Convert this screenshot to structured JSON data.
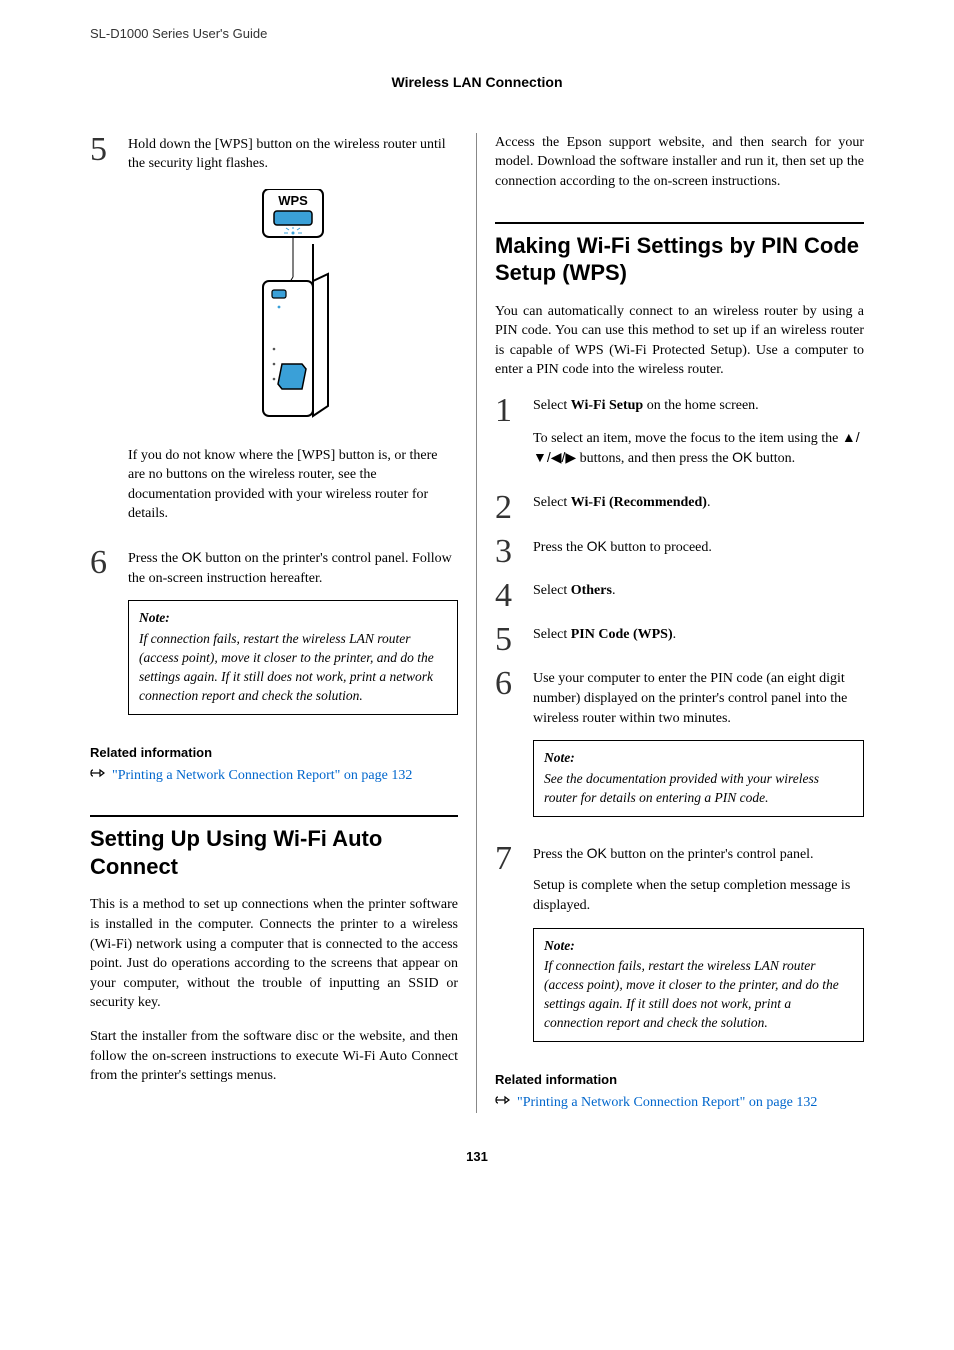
{
  "running_head": "SL-D1000 Series User's Guide",
  "chapter_title": "Wireless LAN Connection",
  "left": {
    "step5": {
      "num": "5",
      "p1": "Hold down the [WPS] button on the wireless router until the security light flashes.",
      "p2": "If you do not know where the [WPS] button is, or there are no buttons on the wireless router, see the documentation provided with your wireless router for details.",
      "wps_label": "WPS"
    },
    "step6": {
      "num": "6",
      "p1_a": "Press the ",
      "p1_ok": "OK",
      "p1_b": " button on the printer's control panel. Follow the on-screen instruction hereafter."
    },
    "note1": {
      "label": "Note:",
      "text": "If connection fails, restart the wireless LAN router (access point), move it closer to the printer, and do the settings again. If it still does not work, print a network connection report and check the solution."
    },
    "related": {
      "label": "Related information",
      "link_a": "\"Printing a Network Connection Report\" on page 132"
    },
    "h2": "Setting Up Using Wi‑Fi Auto Connect",
    "para1": "This is a method to set up connections when the printer software is installed in the computer. Connects the printer to a wireless (Wi‑Fi) network using a computer that is connected to the access point. Just do operations according to the screens that appear on your computer, without the trouble of inputting an SSID or security key.",
    "para2": "Start the installer from the software disc or the website, and then follow the on-screen instructions to execute Wi‑Fi Auto Connect from the printer's settings menus."
  },
  "right": {
    "intro": "Access the Epson support website, and then search for your model. Download the software installer and run it, then set up the connection according to the on-screen instructions.",
    "h2": "Making Wi‑Fi Settings by PIN Code Setup (WPS)",
    "para1": "You can automatically connect to an wireless router by using a PIN code. You can use this method to set up if an wireless router is capable of WPS (Wi‑Fi Protected Setup). Use a computer to enter a PIN code into the wireless router.",
    "step1": {
      "num": "1",
      "p1_a": "Select ",
      "p1_bold": "Wi‑Fi Setup",
      "p1_b": " on the home screen.",
      "p2_a": "To select an item, move the focus to the item using the ",
      "p2_arrows": "▲/▼/◀/▶",
      "p2_b": " buttons, and then press the ",
      "p2_ok": "OK",
      "p2_c": " button."
    },
    "step2": {
      "num": "2",
      "a": "Select ",
      "bold": "Wi‑Fi (Recommended)",
      "b": "."
    },
    "step3": {
      "num": "3",
      "a": "Press the ",
      "ok": "OK",
      "b": " button to proceed."
    },
    "step4": {
      "num": "4",
      "a": "Select ",
      "bold": "Others",
      "b": "."
    },
    "step5": {
      "num": "5",
      "a": "Select ",
      "bold": "PIN Code (WPS)",
      "b": "."
    },
    "step6": {
      "num": "6",
      "p1": "Use your computer to enter the PIN code (an eight digit number) displayed on the printer's control panel into the wireless router within two minutes."
    },
    "note1": {
      "label": "Note:",
      "text": "See the documentation provided with your wireless router for details on entering a PIN code."
    },
    "step7": {
      "num": "7",
      "p1_a": "Press the ",
      "p1_ok": "OK",
      "p1_b": " button on the printer's control panel.",
      "p2": "Setup is complete when the setup completion message is displayed."
    },
    "note2": {
      "label": "Note:",
      "text": "If connection fails, restart the wireless LAN router (access point), move it closer to the printer, and do the settings again. If it still does not work, print a connection report and check the solution."
    },
    "related": {
      "label": "Related information",
      "link_a": "\"Printing a Network Connection Report\" on page 132"
    }
  },
  "page_number": "131"
}
